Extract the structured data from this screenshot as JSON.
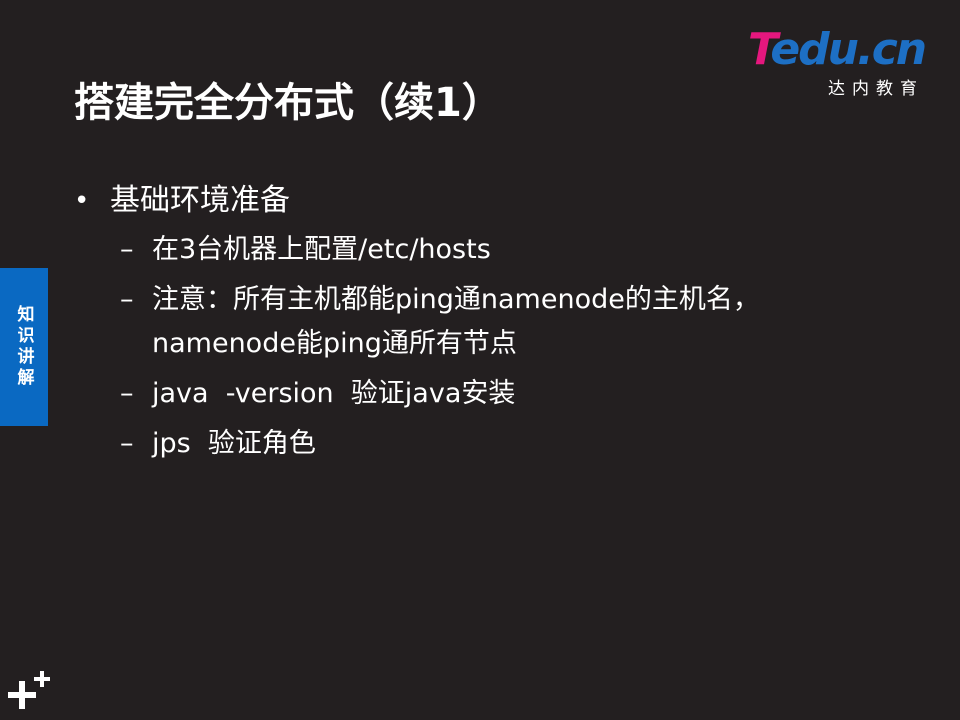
{
  "slide": {
    "title": "搭建完全分布式（续1）",
    "logo": {
      "main_t": "T",
      "main_rest": "edu.cn",
      "subtitle": "达内教育"
    },
    "side_tab": "知识讲解",
    "bullets": [
      {
        "label": "基础环境准备",
        "children": [
          "在3台机器上配置/etc/hosts",
          "注意：所有主机都能ping通namenode的主机名，\nnamenode能ping通所有节点",
          "java  -version  验证java安装",
          "jps  验证角色"
        ]
      }
    ],
    "bullet_mark_l1": "•",
    "bullet_mark_l2": "–",
    "colors": {
      "background": "#231f20",
      "text": "#ffffff",
      "side_tab": "#0a69c2",
      "logo_pink": "#e5177e",
      "logo_blue": "#1d6fc4"
    },
    "icons": [
      "plus-plus-icon"
    ]
  }
}
